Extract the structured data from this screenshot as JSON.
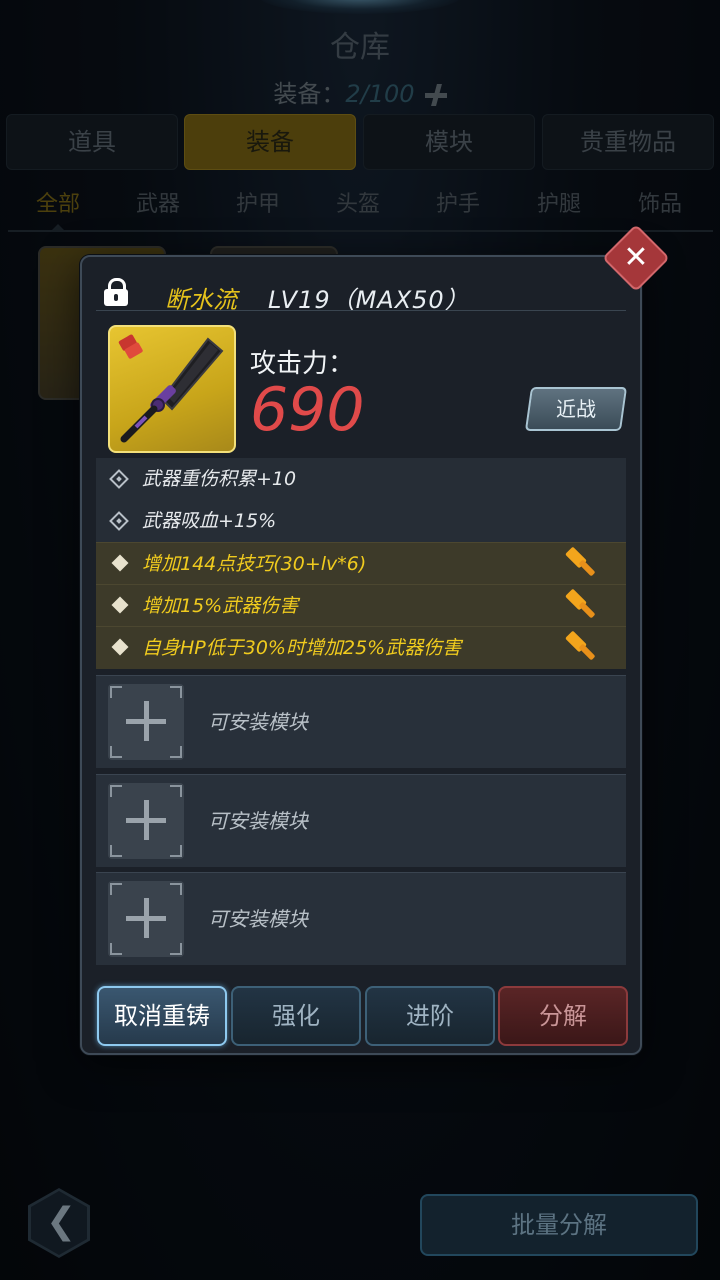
{
  "header": {
    "title": "仓库",
    "capacity_label": "装备：",
    "capacity_value": "2/100"
  },
  "main_tabs": [
    {
      "label": "道具",
      "active": false
    },
    {
      "label": "装备",
      "active": true
    },
    {
      "label": "模块",
      "active": false
    },
    {
      "label": "贵重物品",
      "active": false
    }
  ],
  "sub_tabs": [
    {
      "label": "全部",
      "active": true
    },
    {
      "label": "武器",
      "active": false
    },
    {
      "label": "护甲",
      "active": false
    },
    {
      "label": "头盔",
      "active": false
    },
    {
      "label": "护手",
      "active": false
    },
    {
      "label": "护腿",
      "active": false
    },
    {
      "label": "饰品",
      "active": false
    }
  ],
  "item": {
    "name": "断水流",
    "level": "LV19（MAX50）",
    "attack_label": "攻击力：",
    "attack_value": "690",
    "type_badge": "近战",
    "locked": true
  },
  "attributes": {
    "base": [
      "武器重伤积累+10",
      "武器吸血+15%"
    ],
    "bonus": [
      "增加144点技巧(30+lv*6)",
      "增加15%武器伤害",
      "自身HP低于30%时增加25%武器伤害"
    ]
  },
  "module_slots": [
    {
      "label": "可安装模块"
    },
    {
      "label": "可安装模块"
    },
    {
      "label": "可安装模块"
    }
  ],
  "actions": {
    "cancel_recast": "取消重铸",
    "enhance": "强化",
    "advance": "进阶",
    "decompose": "分解"
  },
  "footer": {
    "batch_decompose": "批量分解"
  },
  "colors": {
    "gold": "#e6c31c",
    "attack_red": "#e04a4a",
    "close_red": "#a5373a"
  }
}
